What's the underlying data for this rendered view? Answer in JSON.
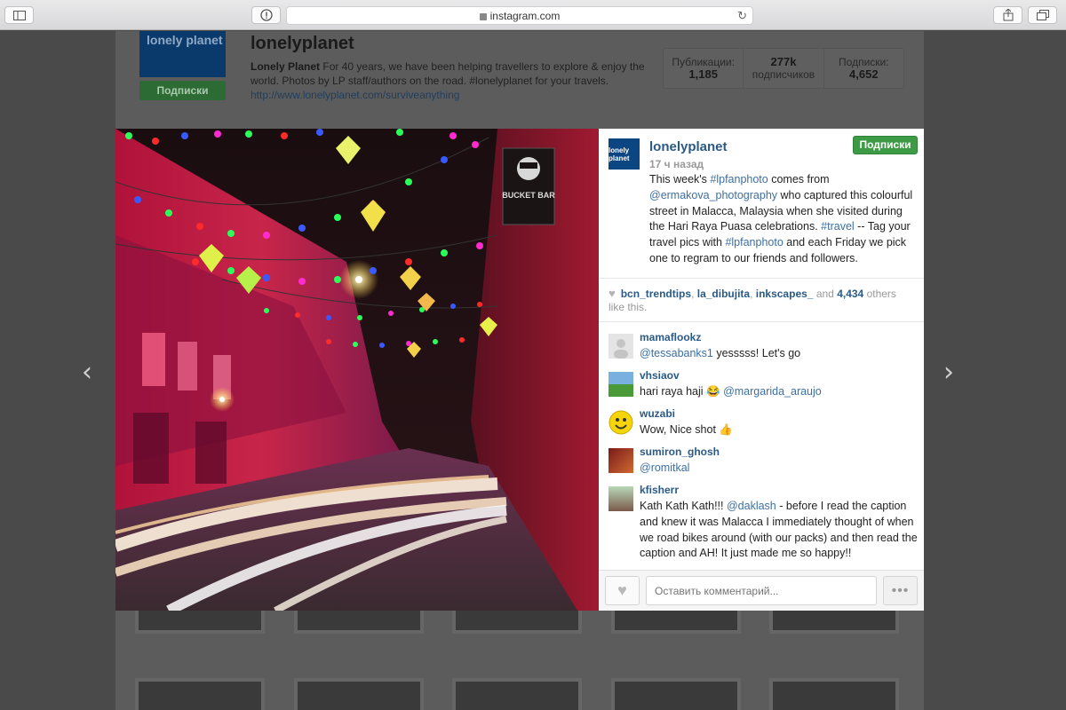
{
  "browser": {
    "url": "instagram.com"
  },
  "profile": {
    "avatar_text": "lonely planet",
    "follow_label": "Подписки",
    "username": "lonelyplanet",
    "bio_name": "Lonely Planet",
    "bio_text": "For 40 years, we have been helping travellers to explore & enjoy the world. Photos by LP staff/authors on the road. #lonelyplanet for your travels.",
    "link": "http://www.lonelyplanet.com/surviveanything",
    "stats": [
      {
        "label": "Публикации:",
        "value": "1,185"
      },
      {
        "label": "подписчиков",
        "value": "277k"
      },
      {
        "label": "Подписки:",
        "value": "4,652"
      }
    ]
  },
  "post": {
    "username": "lonelyplanet",
    "avatar_text": "lonely planet",
    "time": "17 ч назад",
    "follow_label": "Подписки",
    "caption": {
      "p1": "This week's ",
      "tag1": "#lpfanphoto",
      "p2": " comes from ",
      "mention": "@ermakova_photography",
      "p3": " who captured this colourful street in Malacca, Malaysia when she visited during the Hari Raya Puasa celebrations. ",
      "tag2": "#travel",
      "p4": " -- Tag your travel pics with ",
      "tag3": "#lpfanphoto",
      "p5": " and each Friday we pick one to regram to our friends and followers."
    },
    "photo_sign": "BUCKET BAR",
    "likes": {
      "user1": "bcn_trendtips",
      "user2": "la_dibujita",
      "user3": "inkscapes_",
      "and": "and",
      "count": "4,434",
      "suffix": "others like this."
    },
    "comments": [
      {
        "user": "mamaflookz",
        "mention": "@tessabanks1",
        "text": " yesssss! Let's go"
      },
      {
        "user": "vhsiaov",
        "text": "hari raya haji 😂 ",
        "mention": "@margarida_araujo"
      },
      {
        "user": "wuzabi",
        "text": "Wow, Nice shot 👍"
      },
      {
        "user": "sumiron_ghosh",
        "mention": "@romitkal"
      },
      {
        "user": "kfisherr",
        "text1": "Kath Kath Kath!!! ",
        "mention": "@daklash",
        "text2": " - before I read the caption and knew it was Malacca I immediately thought of when we road bikes around (with our packs) and then read the caption and AH! It just made me so happy!!"
      }
    ],
    "comment_placeholder": "Оставить комментарий...",
    "more_label": "•••"
  },
  "colors": {
    "follow_green": "#3d9b45",
    "link_blue": "#2a5a85",
    "tag_blue": "#3d6fa1"
  }
}
